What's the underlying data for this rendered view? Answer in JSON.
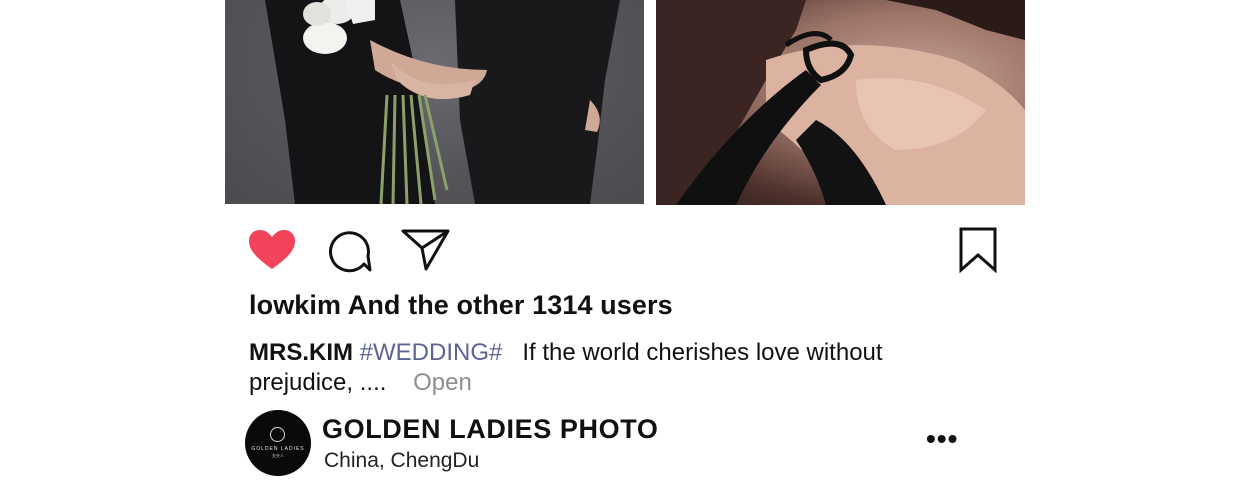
{
  "post": {
    "likes_text": "lowkim And the other 1314 users",
    "caption": {
      "username": "MRS.KIM",
      "hashtag": "#WEDDING#",
      "text": "If the world cherishes love without prejudice, ....",
      "open_label": "Open"
    },
    "actions": {
      "like_icon": "heart-filled-icon",
      "comment_icon": "comment-bubble-icon",
      "share_icon": "paper-plane-icon",
      "bookmark_icon": "bookmark-icon",
      "like_color": "#f1445a"
    }
  },
  "account": {
    "name": "GOLDEN LADIES PHOTO",
    "location_country": "China",
    "location_city": "ChengDu",
    "avatar_brand": "GOLDEN LADIES",
    "avatar_brand_sub": "金夫人",
    "more_label": "•••"
  },
  "colors": {
    "hashtag": "#5c6494",
    "open_link": "#8e8e8e",
    "avatar_bg": "#0a0a0a"
  }
}
